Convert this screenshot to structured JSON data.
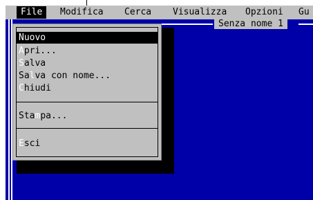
{
  "menubar": {
    "items": [
      {
        "label": "File",
        "active": true
      },
      {
        "label": "Modifica"
      },
      {
        "label": "Cerca"
      },
      {
        "label": "Visualizza"
      },
      {
        "label": "Opzioni"
      },
      {
        "label": "Gu"
      }
    ]
  },
  "document": {
    "title": "Senza nome 1"
  },
  "file_menu": {
    "items": [
      {
        "label": "Nuovo",
        "hotkey_pre": "",
        "hotkey": "",
        "rest": "Nuovo",
        "selected": true
      },
      {
        "hotkey_pre": "",
        "hotkey": "A",
        "rest": "pri..."
      },
      {
        "hotkey_pre": "",
        "hotkey": "S",
        "rest": "alva"
      },
      {
        "hotkey_pre": "Sa",
        "hotkey": "l",
        "rest": "va con nome..."
      },
      {
        "hotkey_pre": "",
        "hotkey": "C",
        "rest": "hiudi"
      },
      {
        "hotkey_pre": "Sta",
        "hotkey": "m",
        "rest": "pa..."
      },
      {
        "hotkey_pre": "",
        "hotkey": "E",
        "rest": "sci"
      }
    ]
  },
  "colors": {
    "background": "#0000a8",
    "menu": "#c0c0c0",
    "highlight": "#000000",
    "hotkey": "#ffffff"
  }
}
